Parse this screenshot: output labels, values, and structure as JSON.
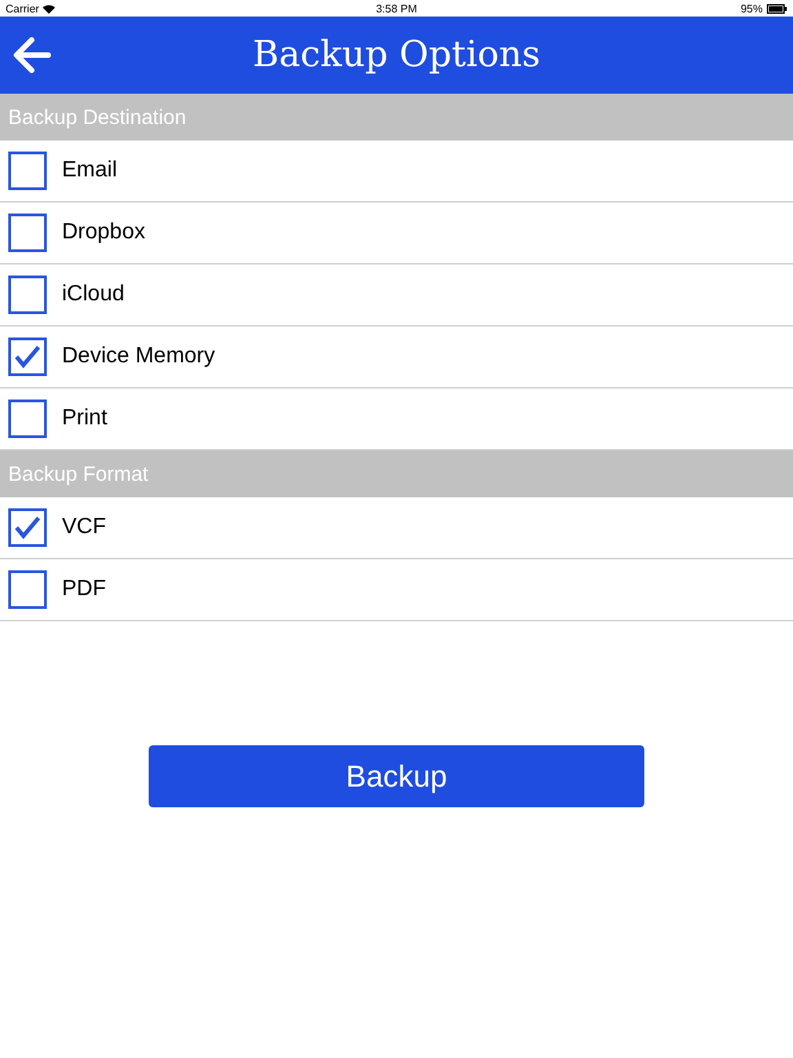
{
  "status_bar": {
    "carrier": "Carrier",
    "time": "3:58 PM",
    "battery": "95%"
  },
  "header": {
    "title": "Backup Options"
  },
  "sections": [
    {
      "title": "Backup Destination",
      "items": [
        {
          "label": "Email",
          "checked": false
        },
        {
          "label": "Dropbox",
          "checked": false
        },
        {
          "label": "iCloud",
          "checked": false
        },
        {
          "label": "Device Memory",
          "checked": true
        },
        {
          "label": "Print",
          "checked": false
        }
      ]
    },
    {
      "title": "Backup Format",
      "items": [
        {
          "label": "VCF",
          "checked": true
        },
        {
          "label": "PDF",
          "checked": false
        }
      ]
    }
  ],
  "button": {
    "label": "Backup"
  }
}
